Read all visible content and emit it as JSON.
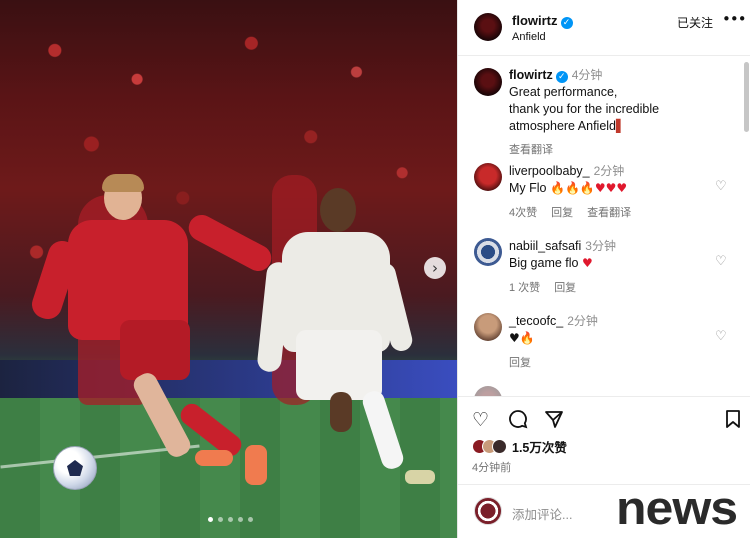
{
  "post": {
    "username": "flowirtz",
    "location": "Anfield",
    "follow_status": "已关注",
    "caption_time": "4分钟",
    "caption_lines": [
      "Great performance,",
      "thank you for the incredible",
      "atmosphere Anfield"
    ],
    "see_translation": "查看翻译",
    "photo_dots": 5,
    "active_dot": 1
  },
  "comments": [
    {
      "username": "liverpoolbaby_",
      "time": "2分钟",
      "text": "My Flo",
      "likes": "4次赞",
      "reply": "回复",
      "translate": "查看翻译"
    },
    {
      "username": "nabiil_safsafi",
      "time": "3分钟",
      "text": "Big game flo",
      "likes": "1 次赞",
      "reply": "回复"
    },
    {
      "username": "_tecoofc_",
      "time": "2分钟",
      "text": "",
      "reply": "回复"
    }
  ],
  "actions": {
    "likes": "1.5万次赞",
    "posted": "4分钟前",
    "add_comment_placeholder": "添加评论..."
  },
  "watermark": "news",
  "icons": {
    "next": "chevron-right-icon",
    "like": "heart-icon",
    "comment": "comment-bubble-icon",
    "share": "paper-plane-icon",
    "save": "bookmark-icon",
    "more": "more-dots-icon",
    "verified": "verified-badge-icon"
  },
  "colors": {
    "verified": "#0095f6",
    "liverpool_red": "#c8202c",
    "secondary_text": "#737373"
  }
}
